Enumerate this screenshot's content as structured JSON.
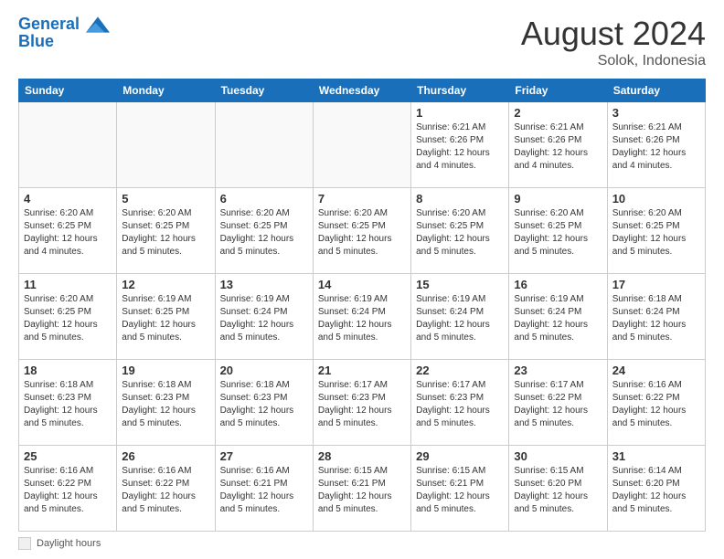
{
  "header": {
    "logo_line1": "General",
    "logo_line2": "Blue",
    "month_year": "August 2024",
    "location": "Solok, Indonesia"
  },
  "calendar": {
    "days_of_week": [
      "Sunday",
      "Monday",
      "Tuesday",
      "Wednesday",
      "Thursday",
      "Friday",
      "Saturday"
    ],
    "weeks": [
      [
        {
          "day": "",
          "info": ""
        },
        {
          "day": "",
          "info": ""
        },
        {
          "day": "",
          "info": ""
        },
        {
          "day": "",
          "info": ""
        },
        {
          "day": "1",
          "info": "Sunrise: 6:21 AM\nSunset: 6:26 PM\nDaylight: 12 hours\nand 4 minutes."
        },
        {
          "day": "2",
          "info": "Sunrise: 6:21 AM\nSunset: 6:26 PM\nDaylight: 12 hours\nand 4 minutes."
        },
        {
          "day": "3",
          "info": "Sunrise: 6:21 AM\nSunset: 6:26 PM\nDaylight: 12 hours\nand 4 minutes."
        }
      ],
      [
        {
          "day": "4",
          "info": "Sunrise: 6:20 AM\nSunset: 6:25 PM\nDaylight: 12 hours\nand 4 minutes."
        },
        {
          "day": "5",
          "info": "Sunrise: 6:20 AM\nSunset: 6:25 PM\nDaylight: 12 hours\nand 5 minutes."
        },
        {
          "day": "6",
          "info": "Sunrise: 6:20 AM\nSunset: 6:25 PM\nDaylight: 12 hours\nand 5 minutes."
        },
        {
          "day": "7",
          "info": "Sunrise: 6:20 AM\nSunset: 6:25 PM\nDaylight: 12 hours\nand 5 minutes."
        },
        {
          "day": "8",
          "info": "Sunrise: 6:20 AM\nSunset: 6:25 PM\nDaylight: 12 hours\nand 5 minutes."
        },
        {
          "day": "9",
          "info": "Sunrise: 6:20 AM\nSunset: 6:25 PM\nDaylight: 12 hours\nand 5 minutes."
        },
        {
          "day": "10",
          "info": "Sunrise: 6:20 AM\nSunset: 6:25 PM\nDaylight: 12 hours\nand 5 minutes."
        }
      ],
      [
        {
          "day": "11",
          "info": "Sunrise: 6:20 AM\nSunset: 6:25 PM\nDaylight: 12 hours\nand 5 minutes."
        },
        {
          "day": "12",
          "info": "Sunrise: 6:19 AM\nSunset: 6:25 PM\nDaylight: 12 hours\nand 5 minutes."
        },
        {
          "day": "13",
          "info": "Sunrise: 6:19 AM\nSunset: 6:24 PM\nDaylight: 12 hours\nand 5 minutes."
        },
        {
          "day": "14",
          "info": "Sunrise: 6:19 AM\nSunset: 6:24 PM\nDaylight: 12 hours\nand 5 minutes."
        },
        {
          "day": "15",
          "info": "Sunrise: 6:19 AM\nSunset: 6:24 PM\nDaylight: 12 hours\nand 5 minutes."
        },
        {
          "day": "16",
          "info": "Sunrise: 6:19 AM\nSunset: 6:24 PM\nDaylight: 12 hours\nand 5 minutes."
        },
        {
          "day": "17",
          "info": "Sunrise: 6:18 AM\nSunset: 6:24 PM\nDaylight: 12 hours\nand 5 minutes."
        }
      ],
      [
        {
          "day": "18",
          "info": "Sunrise: 6:18 AM\nSunset: 6:23 PM\nDaylight: 12 hours\nand 5 minutes."
        },
        {
          "day": "19",
          "info": "Sunrise: 6:18 AM\nSunset: 6:23 PM\nDaylight: 12 hours\nand 5 minutes."
        },
        {
          "day": "20",
          "info": "Sunrise: 6:18 AM\nSunset: 6:23 PM\nDaylight: 12 hours\nand 5 minutes."
        },
        {
          "day": "21",
          "info": "Sunrise: 6:17 AM\nSunset: 6:23 PM\nDaylight: 12 hours\nand 5 minutes."
        },
        {
          "day": "22",
          "info": "Sunrise: 6:17 AM\nSunset: 6:23 PM\nDaylight: 12 hours\nand 5 minutes."
        },
        {
          "day": "23",
          "info": "Sunrise: 6:17 AM\nSunset: 6:22 PM\nDaylight: 12 hours\nand 5 minutes."
        },
        {
          "day": "24",
          "info": "Sunrise: 6:16 AM\nSunset: 6:22 PM\nDaylight: 12 hours\nand 5 minutes."
        }
      ],
      [
        {
          "day": "25",
          "info": "Sunrise: 6:16 AM\nSunset: 6:22 PM\nDaylight: 12 hours\nand 5 minutes."
        },
        {
          "day": "26",
          "info": "Sunrise: 6:16 AM\nSunset: 6:22 PM\nDaylight: 12 hours\nand 5 minutes."
        },
        {
          "day": "27",
          "info": "Sunrise: 6:16 AM\nSunset: 6:21 PM\nDaylight: 12 hours\nand 5 minutes."
        },
        {
          "day": "28",
          "info": "Sunrise: 6:15 AM\nSunset: 6:21 PM\nDaylight: 12 hours\nand 5 minutes."
        },
        {
          "day": "29",
          "info": "Sunrise: 6:15 AM\nSunset: 6:21 PM\nDaylight: 12 hours\nand 5 minutes."
        },
        {
          "day": "30",
          "info": "Sunrise: 6:15 AM\nSunset: 6:20 PM\nDaylight: 12 hours\nand 5 minutes."
        },
        {
          "day": "31",
          "info": "Sunrise: 6:14 AM\nSunset: 6:20 PM\nDaylight: 12 hours\nand 5 minutes."
        }
      ]
    ]
  },
  "footer": {
    "label": "Daylight hours"
  }
}
